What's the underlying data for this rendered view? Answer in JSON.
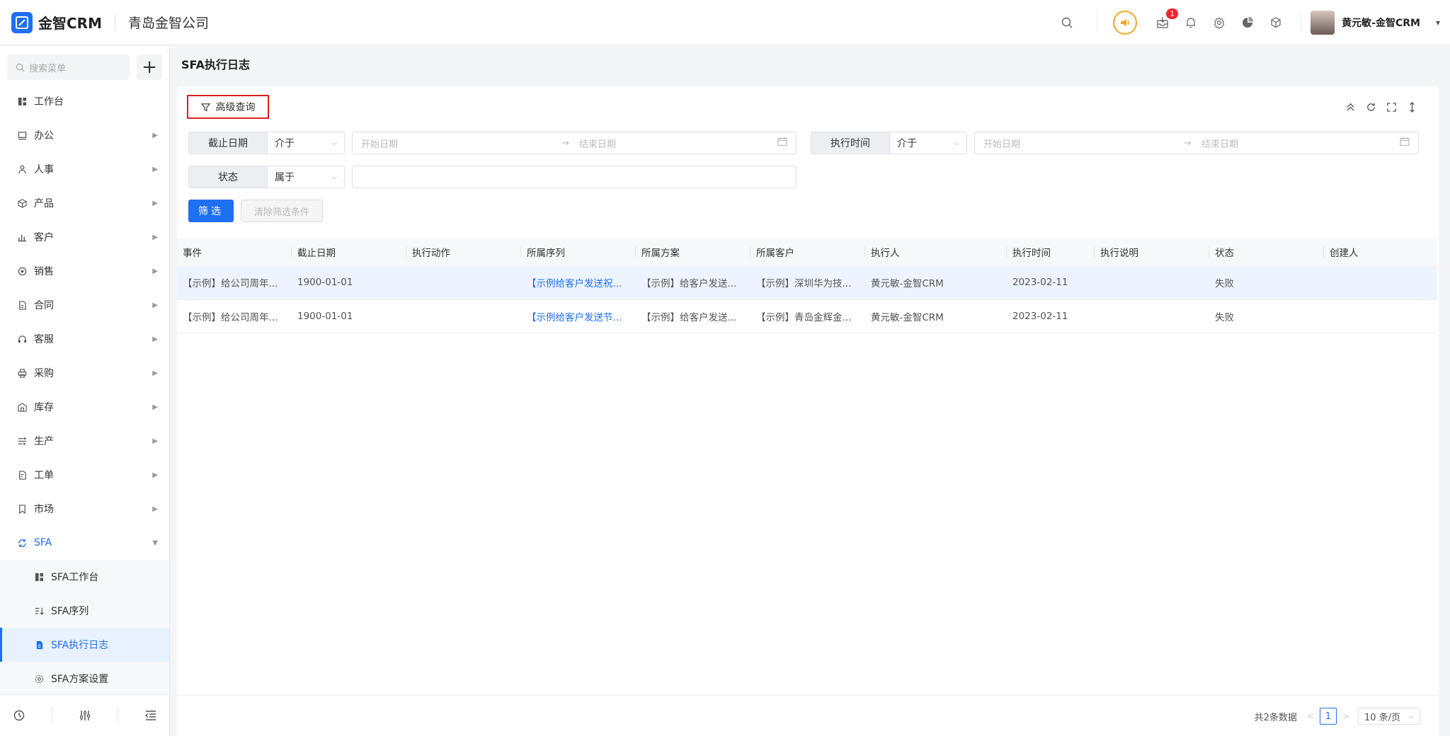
{
  "app": {
    "brand": "金智CRM",
    "company": "青岛金智公司"
  },
  "header": {
    "notification_count": "1",
    "user_name": "黄元敏-金智CRM"
  },
  "sidebar": {
    "search_placeholder": "搜索菜单",
    "items": [
      {
        "label": "工作台",
        "icon": "dashboard-icon"
      },
      {
        "label": "办公",
        "icon": "monitor-icon"
      },
      {
        "label": "人事",
        "icon": "people-icon"
      },
      {
        "label": "产品",
        "icon": "box-icon"
      },
      {
        "label": "客户",
        "icon": "chart-icon"
      },
      {
        "label": "销售",
        "icon": "target-icon"
      },
      {
        "label": "合同",
        "icon": "document-icon"
      },
      {
        "label": "客服",
        "icon": "headset-icon"
      },
      {
        "label": "采购",
        "icon": "printer-icon"
      },
      {
        "label": "库存",
        "icon": "warehouse-icon"
      },
      {
        "label": "生产",
        "icon": "factory-icon"
      },
      {
        "label": "工单",
        "icon": "ticket-icon"
      },
      {
        "label": "市场",
        "icon": "flag-icon"
      },
      {
        "label": "SFA",
        "icon": "cycle-icon"
      }
    ],
    "sfa_children": [
      {
        "label": "SFA工作台"
      },
      {
        "label": "SFA序列"
      },
      {
        "label": "SFA执行日志"
      },
      {
        "label": "SFA方案设置"
      }
    ]
  },
  "page": {
    "title": "SFA执行日志"
  },
  "filters": {
    "advanced_query": "高级查询",
    "deadline_label": "截止日期",
    "deadline_op": "介于",
    "exec_time_label": "执行时间",
    "exec_time_op": "介于",
    "start_placeholder": "开始日期",
    "end_placeholder": "结束日期",
    "status_label": "状态",
    "status_op": "属于",
    "filter_button": "筛选",
    "clear_button": "清除筛选条件"
  },
  "table": {
    "columns": [
      "事件",
      "截止日期",
      "执行动作",
      "所属序列",
      "所属方案",
      "所属客户",
      "执行人",
      "执行时间",
      "执行说明",
      "状态",
      "创建人"
    ],
    "rows": [
      [
        "【示例】给公司周年...",
        "1900-01-01",
        "",
        "【示例给客户发送祝...",
        "【示例】给客户发送...",
        "【示例】深圳华为技...",
        "黄元敏-金智CRM",
        "2023-02-11",
        "",
        "失败",
        ""
      ],
      [
        "【示例】给公司周年...",
        "1900-01-01",
        "",
        "【示例给客户发送节...",
        "【示例】给客户发送...",
        "【示例】青岛金辉金...",
        "黄元敏-金智CRM",
        "2023-02-11",
        "",
        "失败",
        ""
      ]
    ]
  },
  "pagination": {
    "total_text": "共2条数据",
    "current_page": "1",
    "page_size": "10 条/页"
  },
  "colors": {
    "primary": "#1e6ff1",
    "highlight_border": "#e02020",
    "badge": "#f5222d",
    "speaker": "#f5a623"
  }
}
